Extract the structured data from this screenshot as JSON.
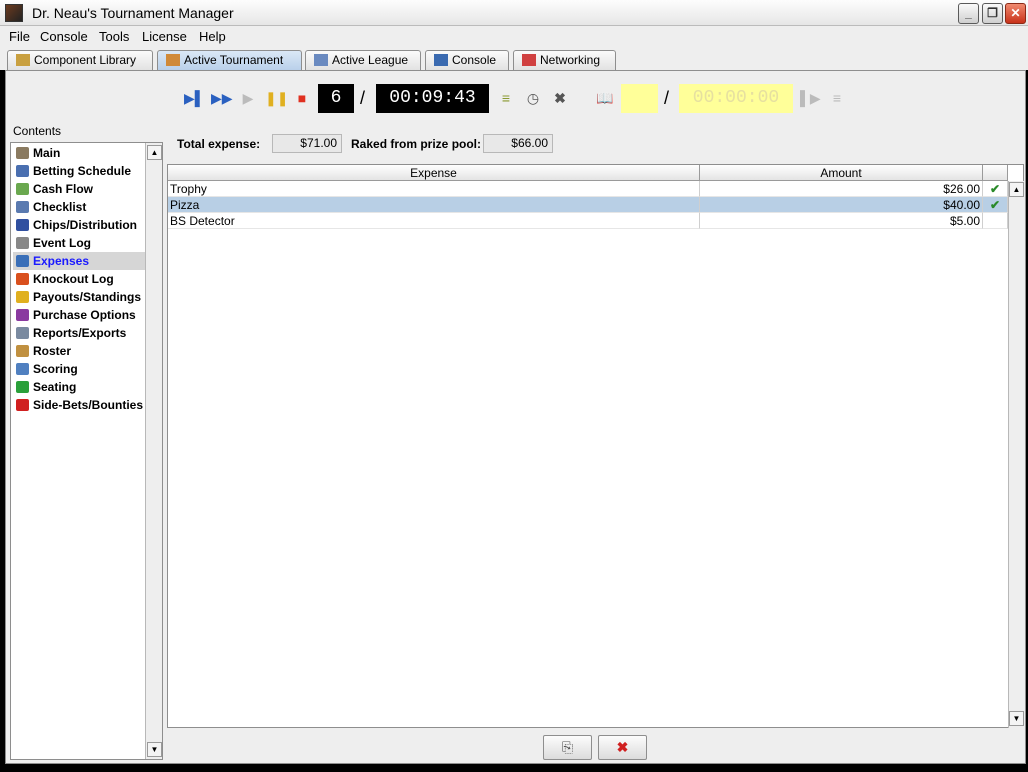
{
  "window": {
    "title": "Dr. Neau's Tournament Manager"
  },
  "menu": [
    "File",
    "Console",
    "Tools",
    "License",
    "Help"
  ],
  "tabs": [
    {
      "label": "Component Library",
      "icon": "books-icon"
    },
    {
      "label": "Active Tournament",
      "icon": "table-grid-icon"
    },
    {
      "label": "Active League",
      "icon": "hierarchy-icon"
    },
    {
      "label": "Console",
      "icon": "monitor-icon"
    },
    {
      "label": "Networking",
      "icon": "network-icon"
    }
  ],
  "toolbar": {
    "level": "6",
    "clock": "00:09:43",
    "break_level": "",
    "break_clock": "00:00:00",
    "slash": "/"
  },
  "sidebar": {
    "heading": "Contents",
    "items": [
      {
        "label": "Main",
        "icon": "house-icon",
        "color": "#8a7a60"
      },
      {
        "label": "Betting Schedule",
        "icon": "schedule-icon",
        "color": "#4a6fb0"
      },
      {
        "label": "Cash Flow",
        "icon": "cash-icon",
        "color": "#6aa84f"
      },
      {
        "label": "Checklist",
        "icon": "checklist-icon",
        "color": "#5a7ab0"
      },
      {
        "label": "Chips/Distribution",
        "icon": "dollar-icon",
        "color": "#3050a0"
      },
      {
        "label": "Event Log",
        "icon": "log-icon",
        "color": "#888888"
      },
      {
        "label": "Expenses",
        "icon": "expenses-icon",
        "color": "#3a6fb8"
      },
      {
        "label": "Knockout Log",
        "icon": "boxing-glove-icon",
        "color": "#d9501e"
      },
      {
        "label": "Payouts/Standings",
        "icon": "trophy-icon",
        "color": "#e0b020"
      },
      {
        "label": "Purchase Options",
        "icon": "chip-stack-icon",
        "color": "#8a3aa0"
      },
      {
        "label": "Reports/Exports",
        "icon": "printer-icon",
        "color": "#7a8aa0"
      },
      {
        "label": "Roster",
        "icon": "people-icon",
        "color": "#c09040"
      },
      {
        "label": "Scoring",
        "icon": "formula-icon",
        "color": "#5080c0"
      },
      {
        "label": "Seating",
        "icon": "table-icon",
        "color": "#2aa03a"
      },
      {
        "label": "Side-Bets/Bounties",
        "icon": "target-icon",
        "color": "#d02020"
      }
    ],
    "selected": "Expenses"
  },
  "summary": {
    "total_label": "Total expense:",
    "total_value": "$71.00",
    "raked_label": "Raked from prize pool:",
    "raked_value": "$66.00"
  },
  "table": {
    "columns": [
      "Expense",
      "Amount",
      ""
    ],
    "rows": [
      {
        "expense": "Trophy",
        "amount": "$26.00",
        "raked": "✔"
      },
      {
        "expense": "Pizza",
        "amount": "$40.00",
        "raked": "✔"
      },
      {
        "expense": "BS Detector",
        "amount": "$5.00",
        "raked": ""
      }
    ],
    "selected_row": 1
  },
  "buttons": {
    "add": "add-expense-icon",
    "delete": "delete-icon"
  },
  "colors": {
    "accent": "#b8cfe5",
    "lcd_bg": "#000000",
    "lcd_off": "#ffff99"
  }
}
